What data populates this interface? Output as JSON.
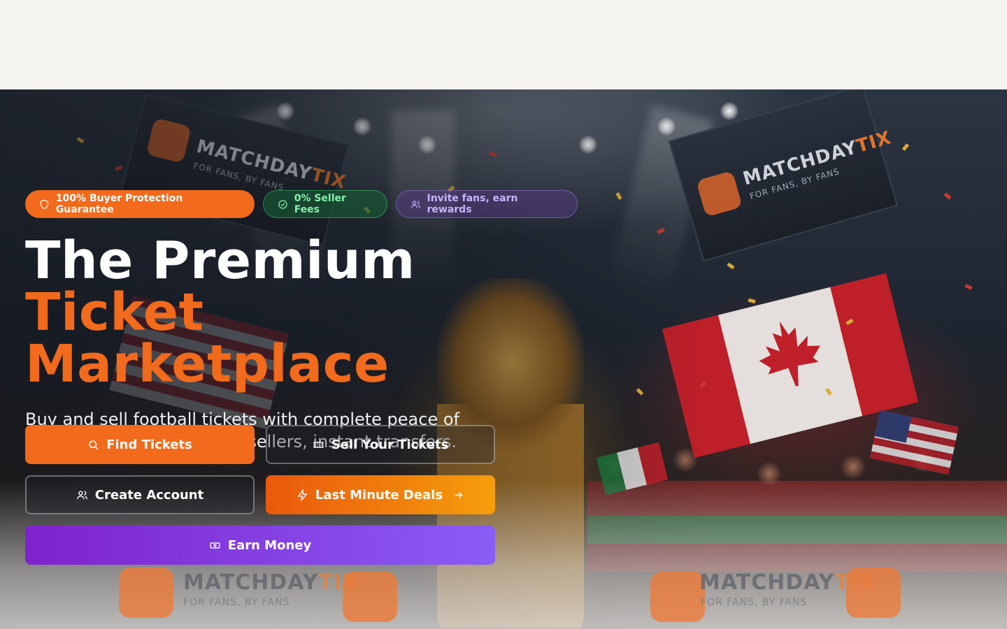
{
  "hero": {
    "badges": {
      "protection": "100% Buyer Protection Guarantee",
      "fees": "0% Seller Fees",
      "invite": "Invite fans, earn rewards"
    },
    "title_line1": "The Premium",
    "title_line2": "Ticket Marketplace",
    "subtitle": "Buy and sell football tickets with complete peace of mind. Secure escrow, real sellers, instant transfers.",
    "buttons": {
      "find": "Find Tickets",
      "sell": "Sell Your Tickets",
      "create": "Create Account",
      "deals": "Last Minute Deals",
      "earn": "Earn Money"
    }
  },
  "background": {
    "brand_main": "MATCHDAY",
    "brand_accent": "TIX",
    "brand_tagline": "FOR FANS, BY FANS"
  },
  "colors": {
    "accent_orange": "#f26a1b",
    "accent_purple": "#8b5cf6",
    "green_badge": "#86efac",
    "purple_badge": "#c4b5fd"
  }
}
